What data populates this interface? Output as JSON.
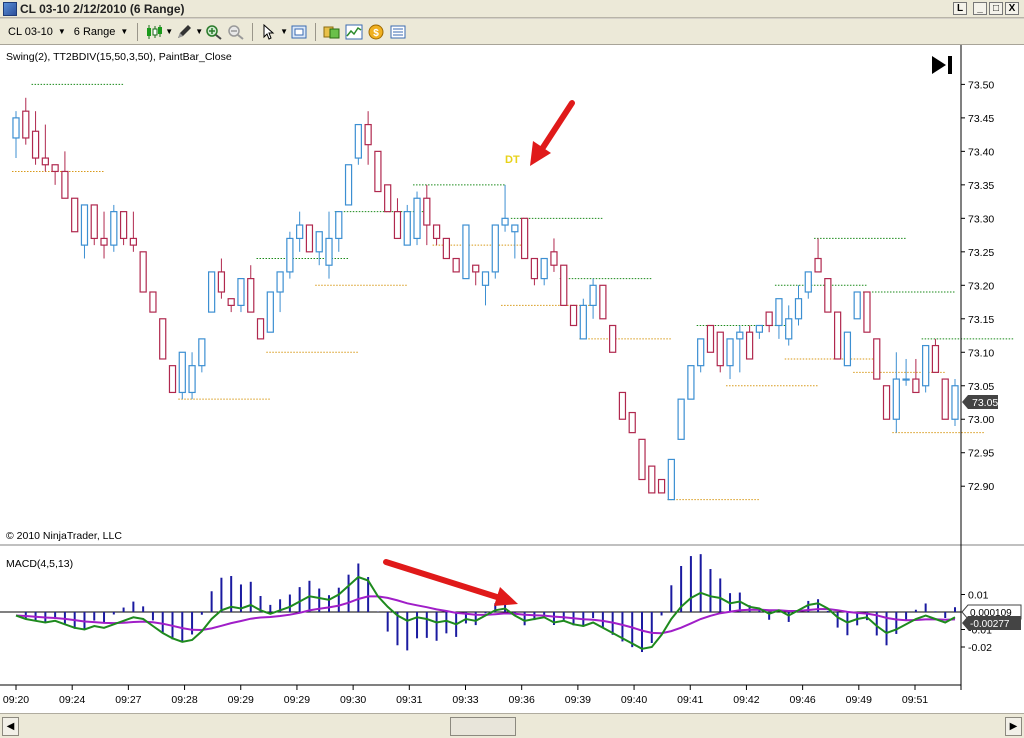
{
  "window": {
    "title": "CL 03-10  2/12/2010 (6 Range)",
    "buttons": [
      "L",
      "_",
      "□",
      "X"
    ]
  },
  "toolbar": {
    "instrument": "CL 03-10",
    "interval": "6 Range",
    "icons": [
      "candlestick-icon",
      "pencil-icon",
      "zoom-in-icon",
      "zoom-out-icon",
      "pointer-icon",
      "properties-icon",
      "data-box-icon",
      "strategy-icon",
      "order-icon",
      "template-icon"
    ]
  },
  "price_panel": {
    "indicators_label": "Swing(2), TT2BDIV(15,50,3,50), PaintBar_Close",
    "copyright": "© 2010 NinjaTrader, LLC",
    "annotation": "DT",
    "last_price": "73.05",
    "y_ticks": [
      "73.50",
      "73.45",
      "73.40",
      "73.35",
      "73.30",
      "73.25",
      "73.20",
      "73.15",
      "73.10",
      "73.05",
      "73.00",
      "72.95",
      "72.90"
    ],
    "colors": {
      "up": "#3c8fd2",
      "down": "#b0284e",
      "swing_high": "#1a8a1a",
      "swing_low": "#d89a1a",
      "annotation": "#e8d21a",
      "arrow": "#e01a1a"
    }
  },
  "macd_panel": {
    "label": "MACD(4,5,13)",
    "y_ticks": [
      "0.01",
      "0",
      "-0.01",
      "-0.02"
    ],
    "badge_macd": "0.000109",
    "badge_avg": "-0.00277",
    "colors": {
      "macd": "#1e8a1e",
      "avg": "#a01ec8",
      "hist": "#1a1aa0"
    }
  },
  "x_ticks": [
    "09:20",
    "09:24",
    "09:27",
    "09:28",
    "09:29",
    "09:29",
    "09:30",
    "09:31",
    "09:33",
    "09:36",
    "09:39",
    "09:40",
    "09:41",
    "09:42",
    "09:46",
    "09:49",
    "09:51"
  ],
  "chart_data": {
    "type": "candlestick",
    "instrument": "CL 03-10",
    "interval": "6 Range",
    "ylim": [
      72.86,
      73.52
    ],
    "candles": [
      [
        73.42,
        73.46,
        73.39,
        73.45
      ],
      [
        73.46,
        73.48,
        73.41,
        73.42
      ],
      [
        73.43,
        73.46,
        73.38,
        73.39
      ],
      [
        73.39,
        73.44,
        73.37,
        73.38
      ],
      [
        73.38,
        73.38,
        73.35,
        73.37
      ],
      [
        73.37,
        73.4,
        73.33,
        73.33
      ],
      [
        73.33,
        73.33,
        73.28,
        73.28
      ],
      [
        73.26,
        73.32,
        73.24,
        73.32
      ],
      [
        73.32,
        73.32,
        73.26,
        73.27
      ],
      [
        73.27,
        73.31,
        73.24,
        73.26
      ],
      [
        73.26,
        73.32,
        73.25,
        73.31
      ],
      [
        73.31,
        73.31,
        73.26,
        73.27
      ],
      [
        73.27,
        73.31,
        73.25,
        73.26
      ],
      [
        73.25,
        73.25,
        73.19,
        73.19
      ],
      [
        73.19,
        73.19,
        73.16,
        73.16
      ],
      [
        73.15,
        73.15,
        73.09,
        73.09
      ],
      [
        73.08,
        73.08,
        73.04,
        73.04
      ],
      [
        73.04,
        73.1,
        73.03,
        73.1
      ],
      [
        73.04,
        73.1,
        73.03,
        73.08
      ],
      [
        73.08,
        73.12,
        73.07,
        73.12
      ],
      [
        73.16,
        73.22,
        73.16,
        73.22
      ],
      [
        73.22,
        73.24,
        73.18,
        73.19
      ],
      [
        73.18,
        73.18,
        73.16,
        73.17
      ],
      [
        73.17,
        73.21,
        73.16,
        73.21
      ],
      [
        73.21,
        73.23,
        73.16,
        73.16
      ],
      [
        73.15,
        73.15,
        73.12,
        73.12
      ],
      [
        73.13,
        73.19,
        73.13,
        73.19
      ],
      [
        73.19,
        73.21,
        73.16,
        73.22
      ],
      [
        73.22,
        73.28,
        73.21,
        73.27
      ],
      [
        73.27,
        73.31,
        73.25,
        73.29
      ],
      [
        73.29,
        73.29,
        73.25,
        73.25
      ],
      [
        73.25,
        73.28,
        73.23,
        73.28
      ],
      [
        73.23,
        73.31,
        73.21,
        73.27
      ],
      [
        73.27,
        73.31,
        73.25,
        73.31
      ],
      [
        73.32,
        73.38,
        73.32,
        73.38
      ],
      [
        73.39,
        73.44,
        73.38,
        73.44
      ],
      [
        73.44,
        73.46,
        73.38,
        73.41
      ],
      [
        73.4,
        73.4,
        73.34,
        73.34
      ],
      [
        73.35,
        73.35,
        73.31,
        73.31
      ],
      [
        73.31,
        73.33,
        73.27,
        73.27
      ],
      [
        73.26,
        73.32,
        73.26,
        73.31
      ],
      [
        73.27,
        73.34,
        73.26,
        73.33
      ],
      [
        73.33,
        73.35,
        73.26,
        73.29
      ],
      [
        73.29,
        73.29,
        73.26,
        73.27
      ],
      [
        73.27,
        73.27,
        73.24,
        73.24
      ],
      [
        73.24,
        73.24,
        73.22,
        73.22
      ],
      [
        73.21,
        73.28,
        73.21,
        73.29
      ],
      [
        73.23,
        73.23,
        73.2,
        73.22
      ],
      [
        73.2,
        73.22,
        73.17,
        73.22
      ],
      [
        73.22,
        73.29,
        73.21,
        73.29
      ],
      [
        73.29,
        73.35,
        73.28,
        73.3
      ],
      [
        73.28,
        73.29,
        73.24,
        73.29
      ],
      [
        73.3,
        73.3,
        73.24,
        73.24
      ],
      [
        73.24,
        73.24,
        73.2,
        73.21
      ],
      [
        73.21,
        73.24,
        73.2,
        73.24
      ],
      [
        73.25,
        73.27,
        73.22,
        73.23
      ],
      [
        73.23,
        73.23,
        73.17,
        73.17
      ],
      [
        73.17,
        73.17,
        73.14,
        73.14
      ],
      [
        73.12,
        73.18,
        73.12,
        73.17
      ],
      [
        73.17,
        73.21,
        73.15,
        73.2
      ],
      [
        73.2,
        73.2,
        73.15,
        73.15
      ],
      [
        73.14,
        73.14,
        73.1,
        73.1
      ],
      [
        73.04,
        73.04,
        73.0,
        73.0
      ],
      [
        73.01,
        73.01,
        72.98,
        72.98
      ],
      [
        72.97,
        72.97,
        72.91,
        72.91
      ],
      [
        72.93,
        72.93,
        72.89,
        72.89
      ],
      [
        72.91,
        72.91,
        72.89,
        72.89
      ],
      [
        72.88,
        72.94,
        72.88,
        72.94
      ],
      [
        72.97,
        73.03,
        72.97,
        73.03
      ],
      [
        73.03,
        73.08,
        73.03,
        73.08
      ],
      [
        73.08,
        73.12,
        73.07,
        73.12
      ],
      [
        73.14,
        73.14,
        73.1,
        73.1
      ],
      [
        73.13,
        73.13,
        73.07,
        73.08
      ],
      [
        73.08,
        73.12,
        73.06,
        73.12
      ],
      [
        73.12,
        73.14,
        73.07,
        73.13
      ],
      [
        73.13,
        73.14,
        73.09,
        73.09
      ],
      [
        73.13,
        73.14,
        73.12,
        73.14
      ],
      [
        73.16,
        73.16,
        73.13,
        73.14
      ],
      [
        73.14,
        73.18,
        73.12,
        73.18
      ],
      [
        73.12,
        73.17,
        73.11,
        73.15
      ],
      [
        73.15,
        73.2,
        73.14,
        73.18
      ],
      [
        73.19,
        73.22,
        73.18,
        73.22
      ],
      [
        73.24,
        73.27,
        73.22,
        73.22
      ],
      [
        73.21,
        73.21,
        73.16,
        73.16
      ],
      [
        73.16,
        73.16,
        73.09,
        73.09
      ],
      [
        73.08,
        73.13,
        73.08,
        73.13
      ],
      [
        73.15,
        73.19,
        73.15,
        73.19
      ],
      [
        73.19,
        73.19,
        73.13,
        73.13
      ],
      [
        73.12,
        73.12,
        73.06,
        73.06
      ],
      [
        73.05,
        73.05,
        73.0,
        73.0
      ],
      [
        73.0,
        73.1,
        72.98,
        73.06
      ],
      [
        73.06,
        73.09,
        73.05,
        73.06
      ],
      [
        73.06,
        73.09,
        73.04,
        73.04
      ],
      [
        73.05,
        73.11,
        73.04,
        73.11
      ],
      [
        73.11,
        73.12,
        73.07,
        73.07
      ],
      [
        73.06,
        73.06,
        73.0,
        73.0
      ],
      [
        73.0,
        73.06,
        72.99,
        73.05
      ]
    ],
    "swing_highs": [
      [
        2,
        73.5
      ],
      [
        25,
        73.24
      ],
      [
        33,
        73.31
      ],
      [
        41,
        73.35
      ],
      [
        51,
        73.3
      ],
      [
        56,
        73.21
      ],
      [
        70,
        73.14
      ],
      [
        78,
        73.2
      ],
      [
        82,
        73.27
      ],
      [
        87,
        73.19
      ],
      [
        93,
        73.12
      ]
    ],
    "swing_lows": [
      [
        0,
        73.37
      ],
      [
        17,
        73.03
      ],
      [
        26,
        73.1
      ],
      [
        31,
        73.2
      ],
      [
        43,
        73.26
      ],
      [
        50,
        73.17
      ],
      [
        58,
        73.12
      ],
      [
        67,
        72.88
      ],
      [
        73,
        73.05
      ],
      [
        79,
        73.09
      ],
      [
        86,
        73.07
      ],
      [
        90,
        72.98
      ]
    ],
    "macd": [
      -0.002,
      -0.004,
      -0.005,
      -0.006,
      -0.005,
      -0.007,
      -0.009,
      -0.01,
      -0.008,
      -0.009,
      -0.007,
      -0.005,
      -0.003,
      -0.004,
      -0.008,
      -0.012,
      -0.015,
      -0.017,
      -0.016,
      -0.011,
      -0.004,
      0.001,
      0.003,
      0.002,
      0.004,
      0.001,
      -0.001,
      0.001,
      0.003,
      0.006,
      0.009,
      0.008,
      0.007,
      0.01,
      0.015,
      0.02,
      0.018,
      0.009,
      0.003,
      -0.002,
      -0.005,
      -0.003,
      -0.004,
      -0.006,
      -0.005,
      -0.007,
      -0.004,
      -0.005,
      -0.002,
      0.001,
      0.002,
      -0.002,
      -0.005,
      -0.004,
      -0.003,
      -0.006,
      -0.005,
      -0.007,
      -0.008,
      -0.006,
      -0.009,
      -0.012,
      -0.015,
      -0.018,
      -0.021,
      -0.02,
      -0.013,
      -0.004,
      0.003,
      0.008,
      0.011,
      0.009,
      0.008,
      0.005,
      0.006,
      0.003,
      0.002,
      -0.001,
      0.001,
      -0.002,
      0.001,
      0.004,
      0.005,
      0.002,
      -0.003,
      -0.006,
      -0.004,
      -0.003,
      -0.008,
      -0.012,
      -0.01,
      -0.007,
      -0.004,
      -0.002,
      -0.004,
      -0.006,
      -0.003
    ]
  }
}
